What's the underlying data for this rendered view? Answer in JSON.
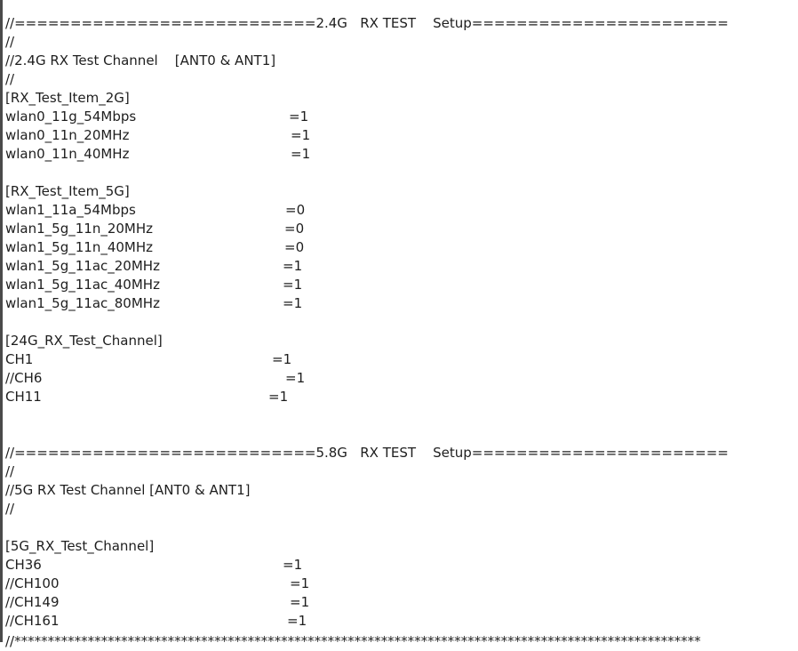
{
  "lines": [
    "//===========================2.4G   RX TEST    Setup=======================",
    "//",
    "//2.4G RX Test Channel    [ANT0 & ANT1]",
    "//",
    "[RX_Test_Item_2G]",
    "wlan0_11g_54Mbps",
    "wlan0_11n_20MHz",
    "wlan0_11n_40MHz",
    "",
    "[RX_Test_Item_5G]",
    "wlan1_11a_54Mbps",
    "wlan1_5g_11n_20MHz",
    "wlan1_5g_11n_40MHz",
    "wlan1_5g_11ac_20MHz",
    "wlan1_5g_11ac_40MHz",
    "wlan1_5g_11ac_80MHz",
    "",
    "[24G_RX_Test_Channel]",
    "CH1",
    "//CH6",
    "CH11",
    "",
    "",
    "//===========================5.8G   RX TEST    Setup=======================",
    "//",
    "//5G RX Test Channel [ANT0 & ANT1]",
    "//",
    "",
    "[5G_RX_Test_Channel]",
    "CH36",
    "//CH100",
    "//CH149",
    "//CH161"
  ],
  "values": {
    "5": "=1",
    "6": "=1",
    "7": "=1",
    "10": "=0",
    "11": "=0",
    "12": "=0",
    "13": "=1",
    "14": "=1",
    "15": "=1",
    "18": "=1",
    "19": "=1",
    "20": "=1",
    "29": "=1",
    "30": "=1",
    "31": "=1",
    "32": "=1"
  },
  "last_line": "//*******************************************************************************************************"
}
